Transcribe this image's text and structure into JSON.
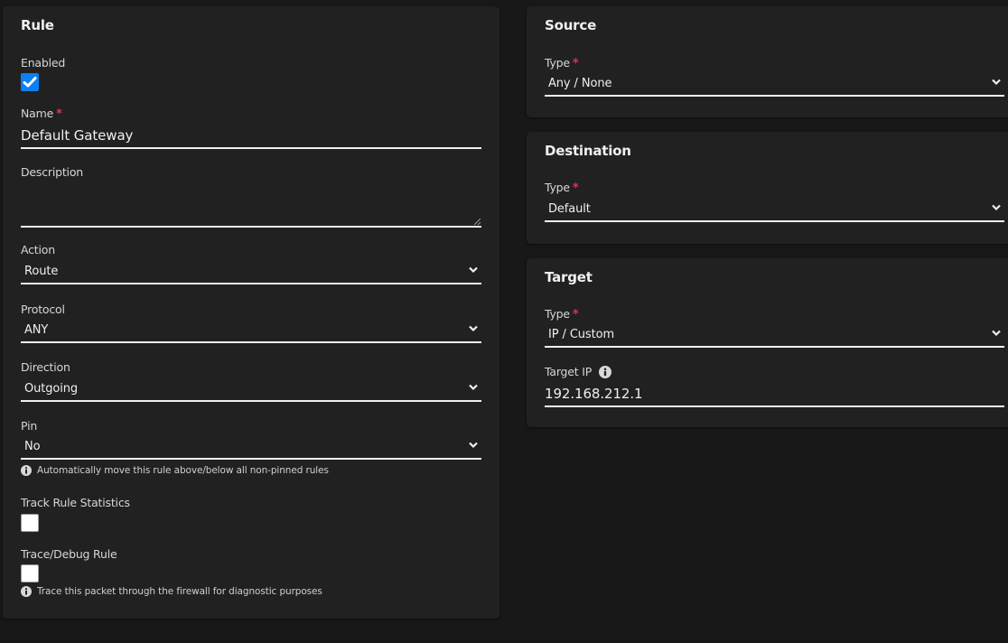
{
  "rule": {
    "title": "Rule",
    "enabled": {
      "label": "Enabled",
      "checked": true
    },
    "name": {
      "label": "Name",
      "required_mark": "*",
      "value": "Default Gateway"
    },
    "description": {
      "label": "Description",
      "value": ""
    },
    "action": {
      "label": "Action",
      "value": "Route"
    },
    "protocol": {
      "label": "Protocol",
      "value": "ANY"
    },
    "direction": {
      "label": "Direction",
      "value": "Outgoing"
    },
    "pin": {
      "label": "Pin",
      "value": "No",
      "help": "Automatically move this rule above/below all non-pinned rules"
    },
    "track_stats": {
      "label": "Track Rule Statistics",
      "checked": false
    },
    "trace_debug": {
      "label": "Trace/Debug Rule",
      "checked": false,
      "help": "Trace this packet through the firewall for diagnostic purposes"
    }
  },
  "source": {
    "title": "Source",
    "type": {
      "label": "Type",
      "required_mark": "*",
      "value": "Any / None"
    }
  },
  "destination": {
    "title": "Destination",
    "type": {
      "label": "Type",
      "required_mark": "*",
      "value": "Default"
    }
  },
  "target": {
    "title": "Target",
    "type": {
      "label": "Type",
      "required_mark": "*",
      "value": "IP / Custom"
    },
    "target_ip": {
      "label": "Target IP",
      "value": "192.168.212.1"
    }
  },
  "colors": {
    "accent": "#0d7ff2",
    "required": "#e0344a",
    "card_bg": "#212121",
    "page_bg": "#181818"
  }
}
